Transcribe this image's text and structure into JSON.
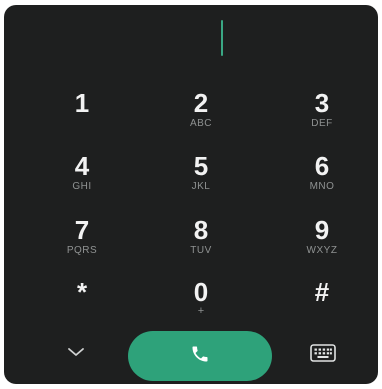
{
  "dialer": {
    "number_value": "",
    "keys": [
      {
        "digit": "1",
        "letters": ""
      },
      {
        "digit": "2",
        "letters": "ABC"
      },
      {
        "digit": "3",
        "letters": "DEF"
      },
      {
        "digit": "4",
        "letters": "GHI"
      },
      {
        "digit": "5",
        "letters": "JKL"
      },
      {
        "digit": "6",
        "letters": "MNO"
      },
      {
        "digit": "7",
        "letters": "PQRS"
      },
      {
        "digit": "8",
        "letters": "TUV"
      },
      {
        "digit": "9",
        "letters": "WXYZ"
      },
      {
        "digit": "*",
        "letters": ""
      },
      {
        "digit": "0",
        "letters": "+"
      },
      {
        "digit": "#",
        "letters": ""
      }
    ],
    "icons": {
      "collapse": "chevron-down-icon",
      "call": "phone-icon",
      "keyboard": "keyboard-icon"
    }
  },
  "colors": {
    "background": "#1e1f1f",
    "digit_text": "#f2f2f2",
    "letters_text": "#8f9292",
    "accent": "#2ea27a",
    "cursor": "#3aa784"
  }
}
